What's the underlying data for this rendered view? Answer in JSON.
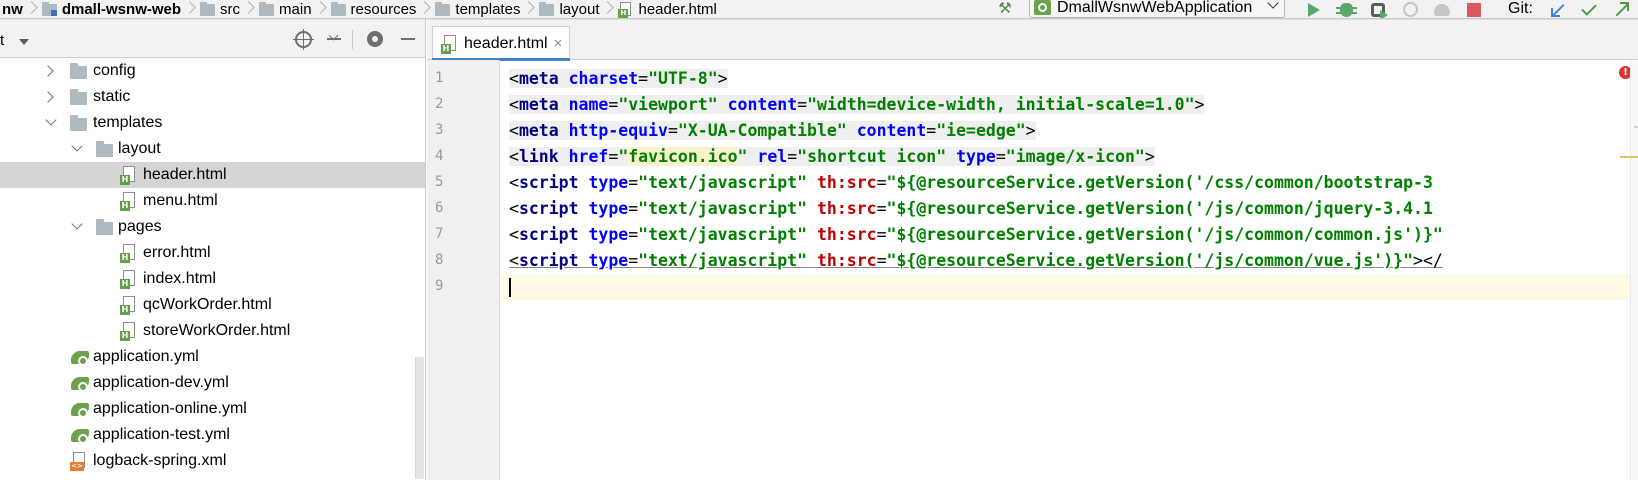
{
  "breadcrumbs": {
    "items": [
      {
        "label": "nw",
        "icon": "",
        "bold": true
      },
      {
        "label": "dmall-wsnw-web",
        "icon": "module-folder-icon",
        "bold": true
      },
      {
        "label": "src",
        "icon": "folder-icon",
        "bold": false
      },
      {
        "label": "main",
        "icon": "folder-icon",
        "bold": false
      },
      {
        "label": "resources",
        "icon": "folder-icon",
        "bold": false
      },
      {
        "label": "templates",
        "icon": "folder-icon",
        "bold": false
      },
      {
        "label": "layout",
        "icon": "folder-icon",
        "bold": false
      },
      {
        "label": "header.html",
        "icon": "html-file-icon",
        "bold": false
      }
    ]
  },
  "toolbar": {
    "run_config": "DmallWsnwWebApplication",
    "git_label": "Git:",
    "buttons": [
      "build-hammer-icon",
      "run-icon",
      "debug-icon",
      "run-with-coverage-icon",
      "profile-icon",
      "attach-icon",
      "stop-icon",
      "git-update-icon",
      "git-commit-icon",
      "git-push-icon"
    ],
    "colors": {
      "run": "#59a869",
      "stop": "#db5860",
      "git_update": "#3c86d8",
      "git_commit": "#4a9a4a"
    }
  },
  "project_panel": {
    "title": "t",
    "tree": [
      {
        "label": "config",
        "type": "folder",
        "state": "collapsed"
      },
      {
        "label": "static",
        "type": "folder",
        "state": "collapsed"
      },
      {
        "label": "templates",
        "type": "folder",
        "state": "expanded"
      },
      {
        "label": "layout",
        "type": "folder",
        "state": "expanded"
      },
      {
        "label": "header.html",
        "type": "html",
        "selected": true
      },
      {
        "label": "menu.html",
        "type": "html"
      },
      {
        "label": "pages",
        "type": "folder",
        "state": "expanded"
      },
      {
        "label": "error.html",
        "type": "html"
      },
      {
        "label": "index.html",
        "type": "html"
      },
      {
        "label": "qcWorkOrder.html",
        "type": "html"
      },
      {
        "label": "storeWorkOrder.html",
        "type": "html"
      },
      {
        "label": "application.yml",
        "type": "yml"
      },
      {
        "label": "application-dev.yml",
        "type": "yml"
      },
      {
        "label": "application-online.yml",
        "type": "yml"
      },
      {
        "label": "application-test.yml",
        "type": "yml"
      },
      {
        "label": "logback-spring.xml",
        "type": "xml"
      }
    ]
  },
  "editor": {
    "tab": {
      "label": "header.html",
      "close": "×"
    },
    "lines": [
      {
        "n": "1",
        "text": "<meta charset=\"UTF-8\">"
      },
      {
        "n": "2",
        "text": "<meta name=\"viewport\" content=\"width=device-width, initial-scale=1.0\">"
      },
      {
        "n": "3",
        "text": "<meta http-equiv=\"X-UA-Compatible\" content=\"ie=edge\">"
      },
      {
        "n": "4",
        "text": "<link href=\"favicon.ico\" rel=\"shortcut icon\" type=\"image/x-icon\">"
      },
      {
        "n": "5",
        "text": "<script type=\"text/javascript\" th:src=\"${@resourceService.getVersion('/css/common/bootstrap-3"
      },
      {
        "n": "6",
        "text": "<script type=\"text/javascript\" th:src=\"${@resourceService.getVersion('/js/common/jquery-3.4.1"
      },
      {
        "n": "7",
        "text": "<script type=\"text/javascript\" th:src=\"${@resourceService.getVersion('/js/common/common.js')}\""
      },
      {
        "n": "8",
        "text": "<script type=\"text/javascript\" th:src=\"${@resourceService.getVersion('/js/common/vue.js')}\"></"
      },
      {
        "n": "9",
        "text": ""
      }
    ],
    "warning_badge": "!",
    "colors": {
      "tag": "#000080",
      "attr": "#0000ff",
      "string": "#008000",
      "thymeleaf_attr": "#c00000",
      "current_line": "#fffae3"
    }
  }
}
